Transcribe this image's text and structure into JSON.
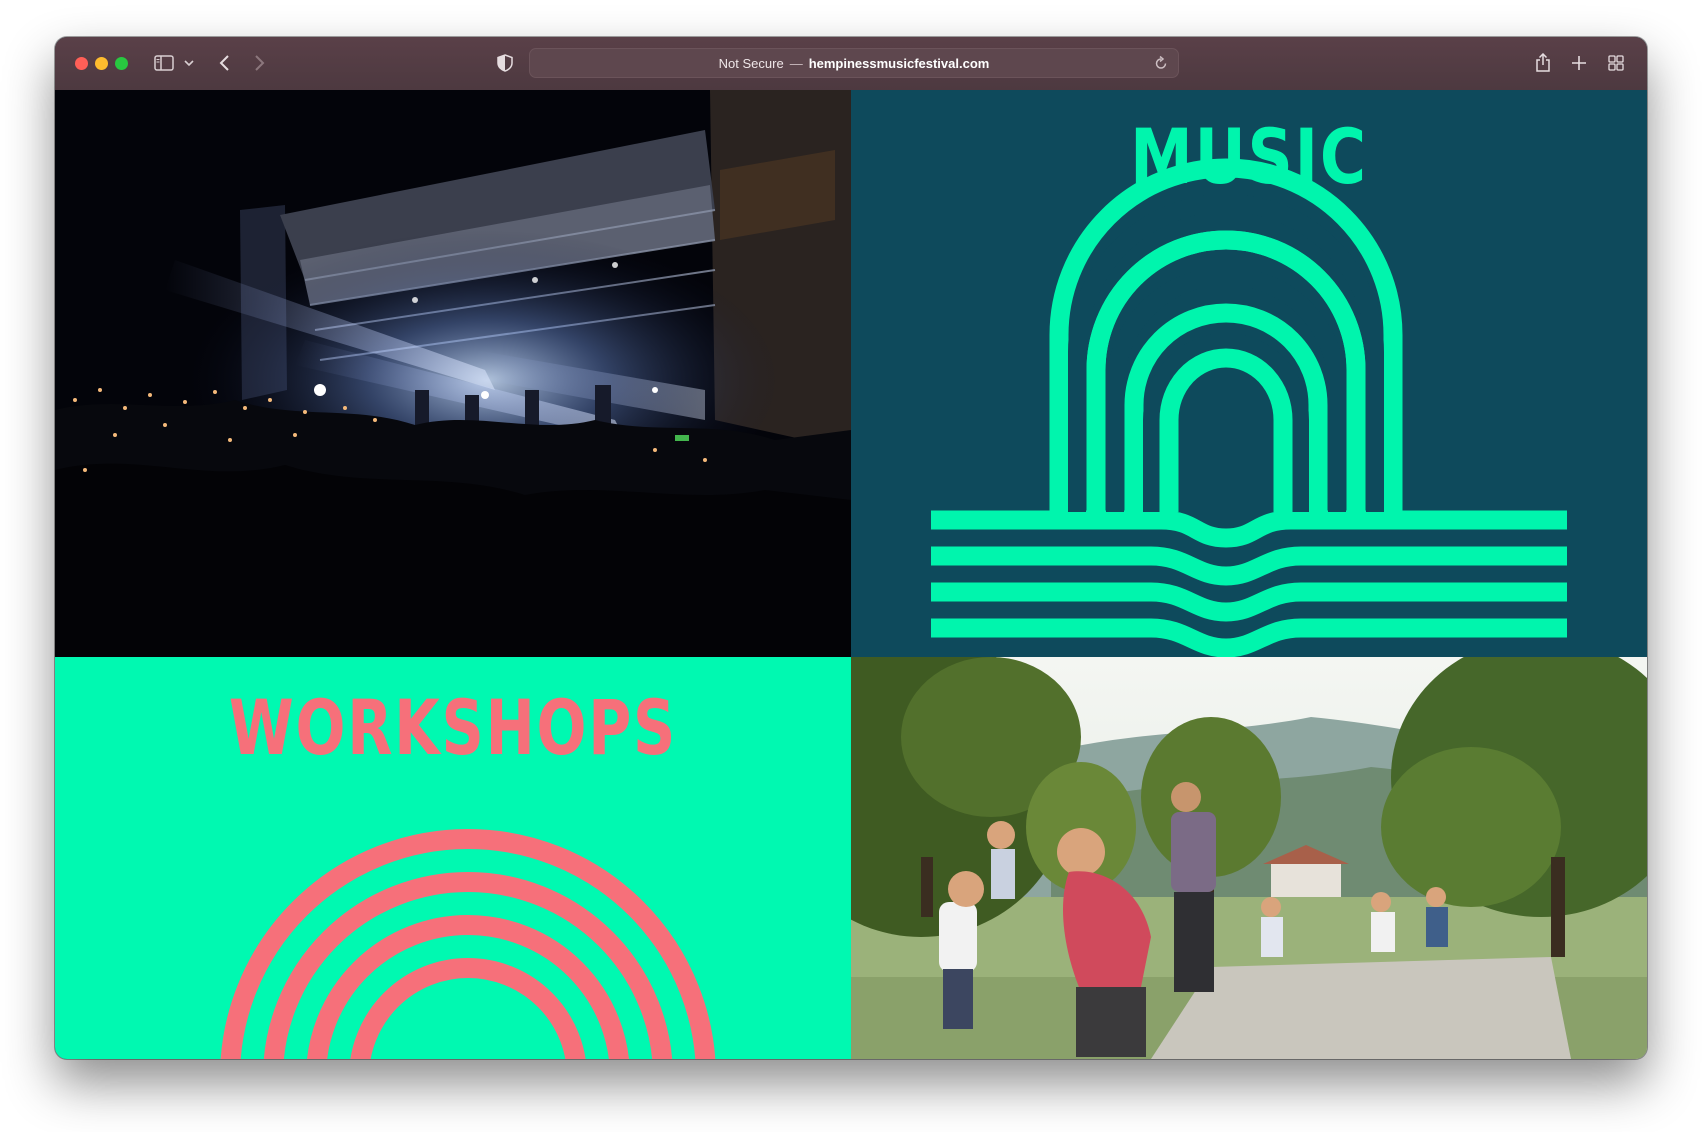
{
  "browser": {
    "address": {
      "security": "Not Secure",
      "separator": "—",
      "domain": "hempinessmusicfestival.com"
    },
    "icons": {
      "sidebar": "sidebar-icon",
      "chevron": "chevron-down-icon",
      "back": "back-arrow-icon",
      "forward": "forward-arrow-icon",
      "shield": "privacy-shield-icon",
      "reload": "reload-icon",
      "share": "share-icon",
      "new_tab": "plus-icon",
      "tab_overview": "tab-grid-icon"
    }
  },
  "tiles": {
    "music": {
      "title": "MUSIC",
      "bg_color": "#0e4a5c",
      "accent_color": "#00f5ad"
    },
    "workshops": {
      "title": "WORKSHOPS",
      "bg_color": "#00f9b1",
      "accent_color": "#f6707a"
    },
    "concert_photo": {
      "subject": "night-concert-stage-crowd"
    },
    "park_photo": {
      "subject": "outdoor-park-workshop-people"
    }
  }
}
